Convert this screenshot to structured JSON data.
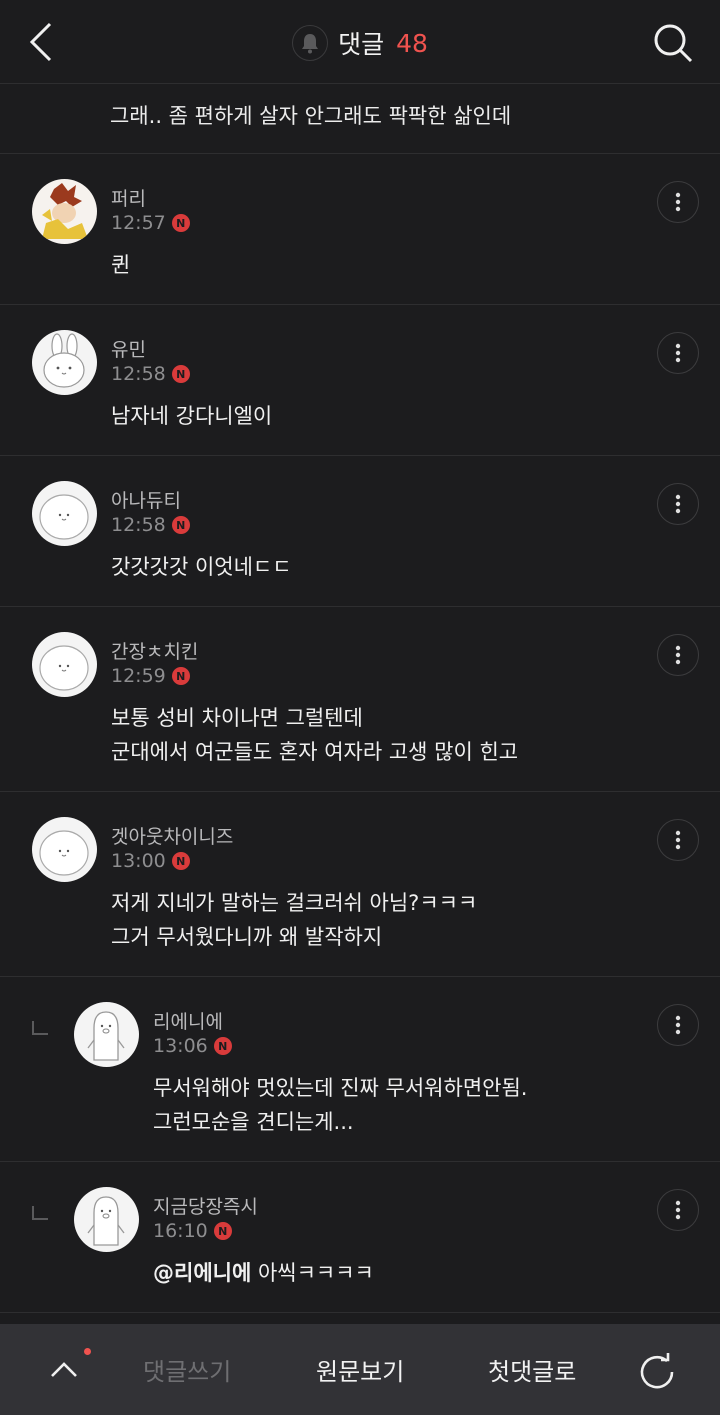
{
  "header": {
    "title": "댓글",
    "count": "48"
  },
  "previous_comment": {
    "text": "그래.. 좀 편하게 살자 안그래도 팍팍한 삶인데"
  },
  "comments": [
    {
      "nick": "퍼리",
      "time": "12:57",
      "badge": "N",
      "lines": [
        "퀸"
      ]
    },
    {
      "nick": "유민",
      "time": "12:58",
      "badge": "N",
      "lines": [
        "남자네 강다니엘이"
      ]
    },
    {
      "nick": "아나듀티",
      "time": "12:58",
      "badge": "N",
      "lines": [
        "갓갓갓갓 이엇네ㄷㄷ"
      ]
    },
    {
      "nick": "간장ㅊ치킨",
      "time": "12:59",
      "badge": "N",
      "lines": [
        "보통 성비 차이나면 그럴텐데",
        "군대에서 여군들도 혼자 여자라 고생 많이 힌고"
      ]
    },
    {
      "nick": "겟아웃차이니즈",
      "time": "13:00",
      "badge": "N",
      "lines": [
        "저게 지네가 말하는 걸크러쉬 아님?ㅋㅋㅋ",
        "그거 무서웠다니까 왜 발작하지"
      ]
    },
    {
      "nick": "리에니에",
      "time": "13:06",
      "badge": "N",
      "lines": [
        "무서워해야 멋있는데 진짜 무서워하면안됨.",
        "그런모순을 견디는게..."
      ]
    },
    {
      "nick": "지금당장즉시",
      "time": "16:10",
      "badge": "N",
      "mention": "@리에니에",
      "lines": [
        " 아씩ㅋㅋㅋㅋ"
      ]
    }
  ],
  "bottom_bar": {
    "write": "댓글쓰기",
    "original": "원문보기",
    "first": "첫댓글로"
  },
  "colors": {
    "background": "#1c1c1e",
    "accent": "#f0534f",
    "badge": "#d93b3b",
    "bottom_bar": "#323236"
  },
  "icons": [
    "back-icon",
    "bell-icon",
    "search-icon",
    "more-icon",
    "chevron-up-icon",
    "refresh-icon",
    "reply-arrow-icon",
    "new-badge-icon"
  ]
}
